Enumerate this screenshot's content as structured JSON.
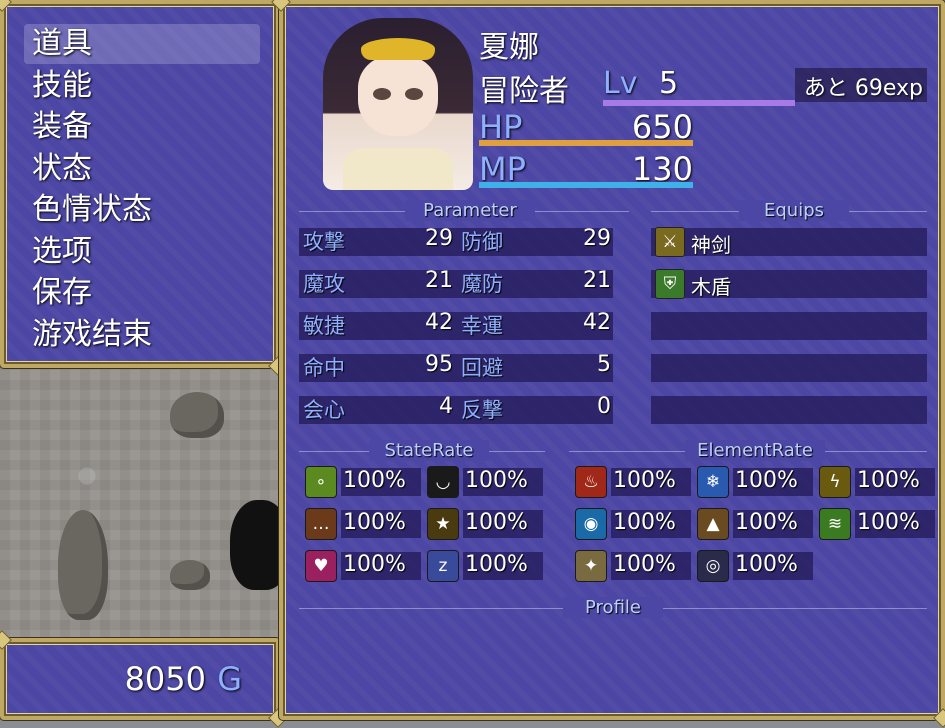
{
  "menu": {
    "items": [
      "道具",
      "技能",
      "装备",
      "状态",
      "色情状态",
      "选项",
      "保存",
      "游戏结束"
    ],
    "selected": 0
  },
  "gold": {
    "amount": "8050",
    "unit": "G"
  },
  "actor": {
    "name": "夏娜",
    "class": "冒险者",
    "level_label": "Lv",
    "level": "5",
    "exp_text": "あと 69exp",
    "hp_label": "HP",
    "hp": "650",
    "mp_label": "MP",
    "mp": "130",
    "hp_color": "#e0a040",
    "mp_color": "#40b0e8"
  },
  "sections": {
    "parameter": "Parameter",
    "equips": "Equips",
    "state_rate": "StateRate",
    "element_rate": "ElementRate",
    "profile": "Profile"
  },
  "params": [
    {
      "l1": "攻撃",
      "v1": "29",
      "l2": "防御",
      "v2": "29"
    },
    {
      "l1": "魔攻",
      "v1": "21",
      "l2": "魔防",
      "v2": "21"
    },
    {
      "l1": "敏捷",
      "v1": "42",
      "l2": "幸運",
      "v2": "42"
    },
    {
      "l1": "命中",
      "v1": "95",
      "l2": "回避",
      "v2": "5"
    },
    {
      "l1": "会心",
      "v1": "4",
      "l2": "反撃",
      "v2": "0"
    }
  ],
  "equips": [
    {
      "name": "神剑",
      "icon": "sword-icon",
      "color": "#7a6a20"
    },
    {
      "name": "木盾",
      "icon": "shield-icon",
      "color": "#3a7a2a"
    },
    {
      "name": "",
      "icon": ""
    },
    {
      "name": "",
      "icon": ""
    },
    {
      "name": "",
      "icon": ""
    }
  ],
  "state_rates": [
    {
      "icon": "poison-bubbles-icon",
      "color": "#5a8a20",
      "glyph": "∘",
      "value": "100%"
    },
    {
      "icon": "closed-eye-icon",
      "color": "#1a1a1a",
      "glyph": "◡",
      "value": "100%"
    },
    {
      "icon": "speech-bubble-icon",
      "color": "#6a3a1a",
      "glyph": "…",
      "value": "100%"
    },
    {
      "icon": "dizzy-stars-icon",
      "color": "#4a3a10",
      "glyph": "★",
      "value": "100%"
    },
    {
      "icon": "heart-icon",
      "color": "#9a2060",
      "glyph": "♥",
      "value": "100%"
    },
    {
      "icon": "sleep-zzz-icon",
      "color": "#3a4a9a",
      "glyph": "z",
      "value": "100%"
    }
  ],
  "element_rates": [
    {
      "icon": "fire-icon",
      "color": "#a02818",
      "glyph": "♨",
      "value": "100%"
    },
    {
      "icon": "ice-snowflake-icon",
      "color": "#2a5ab0",
      "glyph": "❄",
      "value": "100%"
    },
    {
      "icon": "thunder-icon",
      "color": "#6a5a10",
      "glyph": "ϟ",
      "value": "100%"
    },
    {
      "icon": "water-drop-icon",
      "color": "#1a6aa8",
      "glyph": "◉",
      "value": "100%"
    },
    {
      "icon": "earth-rock-icon",
      "color": "#6a4a20",
      "glyph": "▲",
      "value": "100%"
    },
    {
      "icon": "wind-tornado-icon",
      "color": "#3a7a20",
      "glyph": "≋",
      "value": "100%"
    },
    {
      "icon": "light-holy-icon",
      "color": "#7a6a40",
      "glyph": "✦",
      "value": "100%"
    },
    {
      "icon": "dark-vortex-icon",
      "color": "#2a2a4a",
      "glyph": "◎",
      "value": "100%"
    }
  ]
}
